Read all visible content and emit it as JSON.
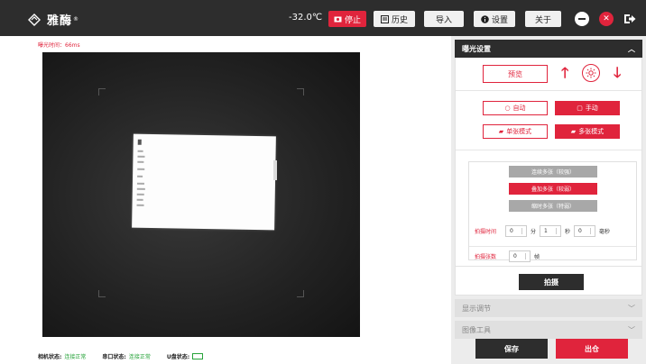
{
  "app": {
    "logo_text": "雅酶",
    "logo_mark": "®"
  },
  "titlebar": {
    "temperature": "-32.0℃",
    "stop_label": "停止",
    "history_label": "历史",
    "import_label": "导入",
    "settings_label": "设置",
    "about_label": "关于",
    "close_symbol": "✕"
  },
  "viewer": {
    "exposure_time": "曝光时间：66ms"
  },
  "status": {
    "camera_label": "相机状态:",
    "camera_value": "连接正常",
    "serial_label": "串口状态:",
    "serial_value": "连接正常",
    "usb_label": "U盘状态:"
  },
  "exposure": {
    "header": "曝光设置",
    "preview_label": "预览",
    "auto_label": "自动",
    "manual_label": "手动",
    "single_mode_label": "单张模式",
    "multi_mode_label": "多张模式",
    "continuous_label": "连续多张（较强）",
    "superimpose_label": "叠加多张（较弱）",
    "timelapse_label": "缩时多张（特弱）",
    "shoot_time_label": "拍摄时间",
    "minutes_value": "0",
    "minutes_unit": "分",
    "seconds_value": "1",
    "seconds_unit": "秒",
    "ms_value": "0",
    "ms_unit": "毫秒",
    "frame_count_label": "拍摄张数",
    "frame_count_value": "0",
    "frame_unit": "帧",
    "capture_label": "拍摄"
  },
  "display": {
    "header": "显示调节"
  },
  "tools": {
    "header": "图像工具"
  },
  "footer": {
    "save_label": "保存",
    "quit_label": "出仓"
  },
  "colors": {
    "accent": "#e0243c",
    "dark": "#2d2d2d",
    "ok": "#27a33a"
  }
}
